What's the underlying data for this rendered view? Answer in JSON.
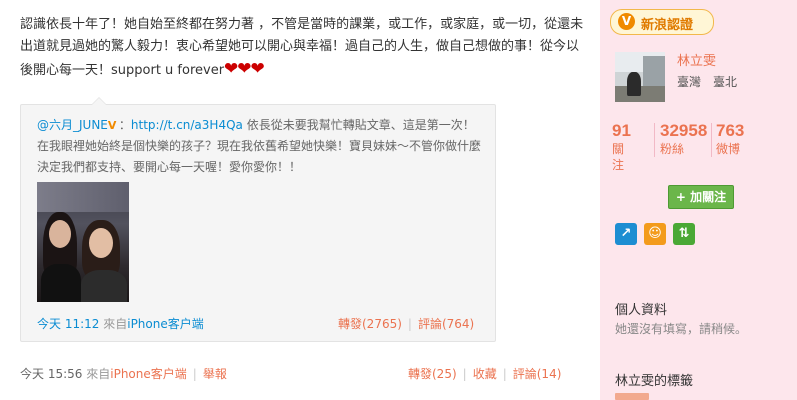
{
  "post": {
    "text": "認識依長十年了！她自始至終都在努力著 ，不管是當時的課業，或工作，或家庭，或一切，從還未出道就見過她的驚人毅力！衷心希望她可以開心與幸福！過自己的人生，做自己想做的事！從今以後開心每一天！support u forever",
    "hearts": "❤❤❤",
    "time": "今天 15:56",
    "source_prefix": "來自",
    "source": "iPhone客户端",
    "report": "舉報",
    "repost": "轉發(25)",
    "favorite": "收藏",
    "comment": "評論(14)"
  },
  "quoted": {
    "author": "@六月_JUNE",
    "colon": "：",
    "link": "http://t.cn/a3H4Qa",
    "text": " 依長從未要我幫忙轉貼文章、這是第一次！在我眼裡她始終是個快樂的孩子？現在我依舊希望她快樂！寶貝妹妹～不管你做什麼決定我們都支持、要開心每一天喔！愛你愛你！！",
    "time": "今天 11:12",
    "source_prefix": " 來自",
    "source": "iPhone客户端",
    "repost": "轉發(2765)",
    "comment": "評論(764)"
  },
  "sidebar": {
    "badge": "新浪認證",
    "badge_icon": "V",
    "name": "林立雯",
    "location": "臺灣　臺北",
    "stats": [
      {
        "num": "91",
        "label": "關注"
      },
      {
        "num": "32958",
        "label": "粉絲"
      },
      {
        "num": "763",
        "label": "微博"
      }
    ],
    "follow": "+ 加關注",
    "profile_title": "個人資料",
    "profile_body": "她還沒有填寫，請稍候。",
    "tags_title": "林立雯的標籤"
  },
  "colors": {
    "accent": "#eb7350",
    "link": "#0a8cd2",
    "sidebar_bg": "#fde6ec",
    "follow_green": "#6bb64a"
  }
}
